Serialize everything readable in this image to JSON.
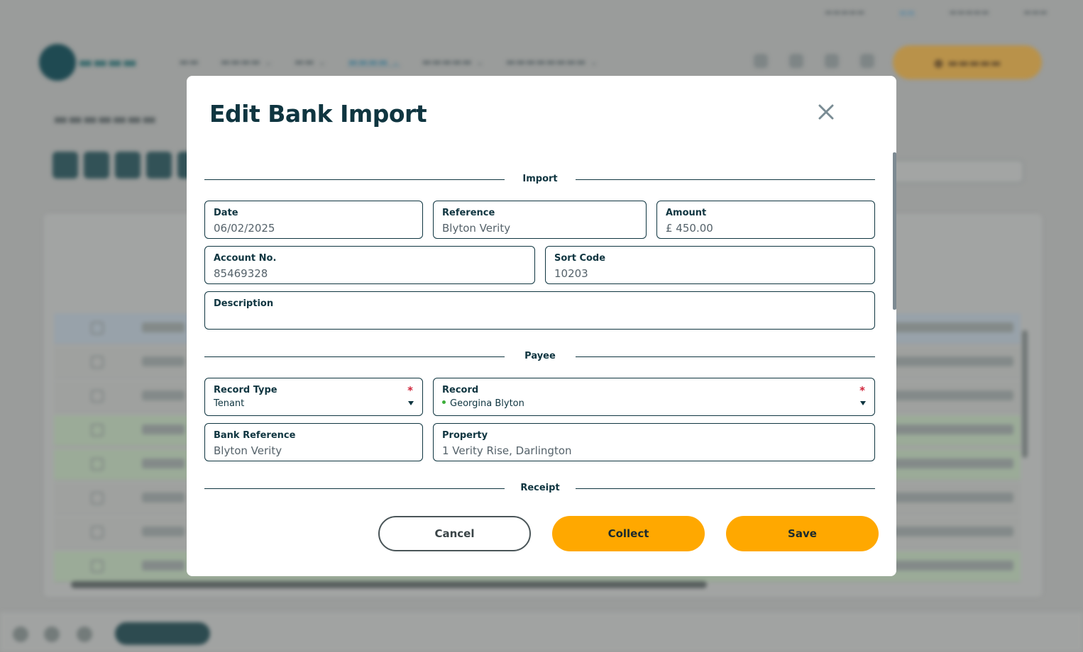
{
  "background": {
    "topbar_links": [
      "",
      "",
      "",
      ""
    ],
    "my_account_label": ""
  },
  "modal": {
    "title": "Edit Bank Import",
    "close_icon": "close-icon",
    "sections": {
      "import": "Import",
      "payee": "Payee",
      "receipt": "Receipt"
    },
    "fields": {
      "date": {
        "label": "Date",
        "value": "06/02/2025"
      },
      "reference": {
        "label": "Reference",
        "value": "Blyton  Verity"
      },
      "amount": {
        "label": "Amount",
        "value": "£ 450.00"
      },
      "account_no": {
        "label": "Account No.",
        "value": "85469328"
      },
      "sort_code": {
        "label": "Sort Code",
        "value": "10203"
      },
      "description": {
        "label": "Description",
        "value": ""
      },
      "record_type": {
        "label": "Record Type",
        "value": "Tenant",
        "required_mark": "*"
      },
      "record": {
        "label": "Record",
        "value": "Georgina Blyton",
        "required_mark": "*"
      },
      "bank_reference": {
        "label": "Bank Reference",
        "value": "Blyton  Verity"
      },
      "property": {
        "label": "Property",
        "value": "1 Verity Rise, Darlington"
      }
    },
    "buttons": {
      "cancel": "Cancel",
      "collect": "Collect",
      "save": "Save"
    }
  },
  "colors": {
    "primary_text": "#0f3540",
    "accent": "#ffa800",
    "required": "#d0243a",
    "status_dot": "#3cae3a"
  }
}
